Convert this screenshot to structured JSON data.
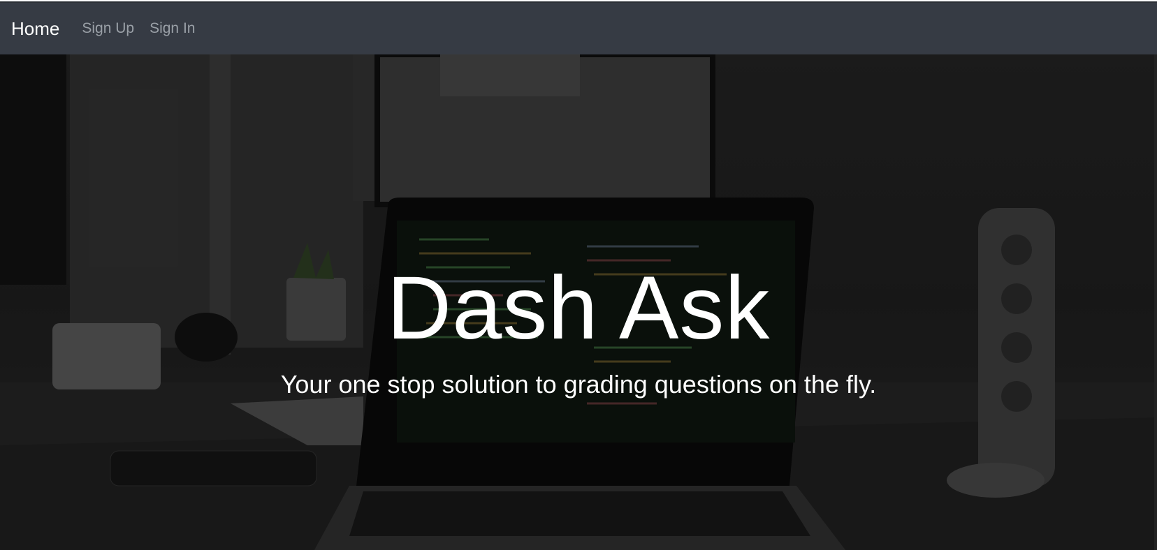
{
  "nav": {
    "brand": "Home",
    "links": [
      "Sign Up",
      "Sign In"
    ]
  },
  "hero": {
    "title": "Dash Ask",
    "subtitle": "Your one stop solution to grading questions on the fly."
  },
  "colors": {
    "navbar_bg": "#363b44",
    "nav_link": "#9aa0a7",
    "text": "#ffffff"
  }
}
